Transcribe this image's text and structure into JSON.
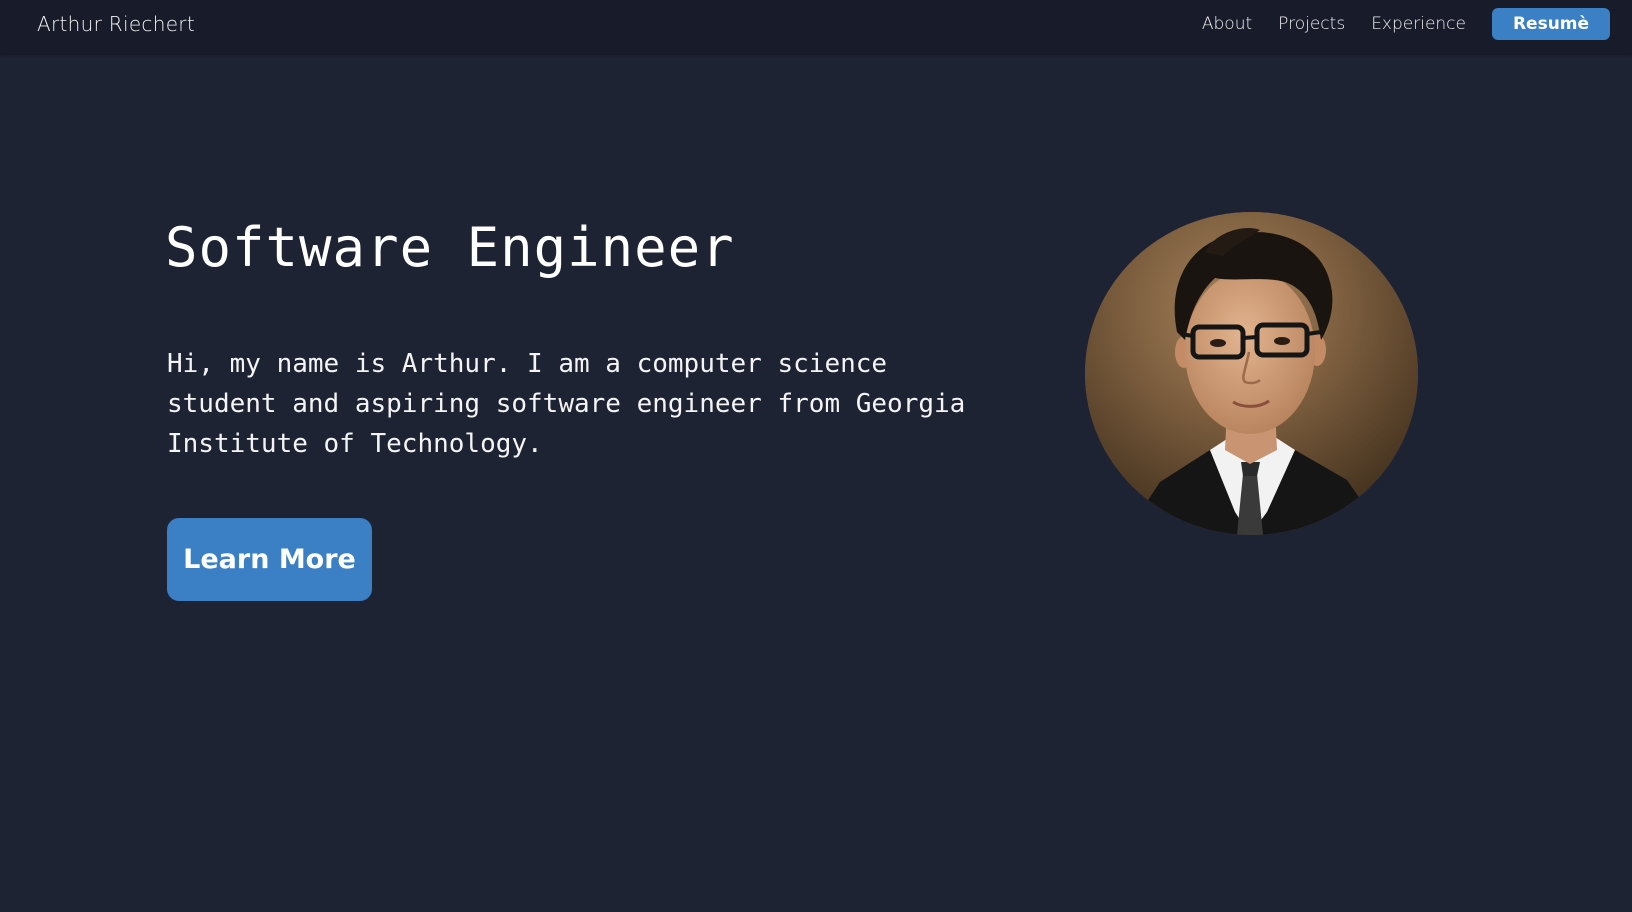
{
  "nav": {
    "brand": "Arthur Riechert",
    "links": [
      {
        "label": "About"
      },
      {
        "label": "Projects"
      },
      {
        "label": "Experience"
      }
    ],
    "resume_label": "Resumè"
  },
  "hero": {
    "title": "Software Engineer",
    "description": "Hi, my name is Arthur. I am a computer science student and aspiring software engineer from Georgia Institute of Technology.",
    "cta_label": "Learn More"
  },
  "colors": {
    "page_background": "#1e2334",
    "navbar_background": "#181c2a",
    "accent": "#3b7fc4"
  },
  "icons": {
    "profile": "profile-photo"
  }
}
